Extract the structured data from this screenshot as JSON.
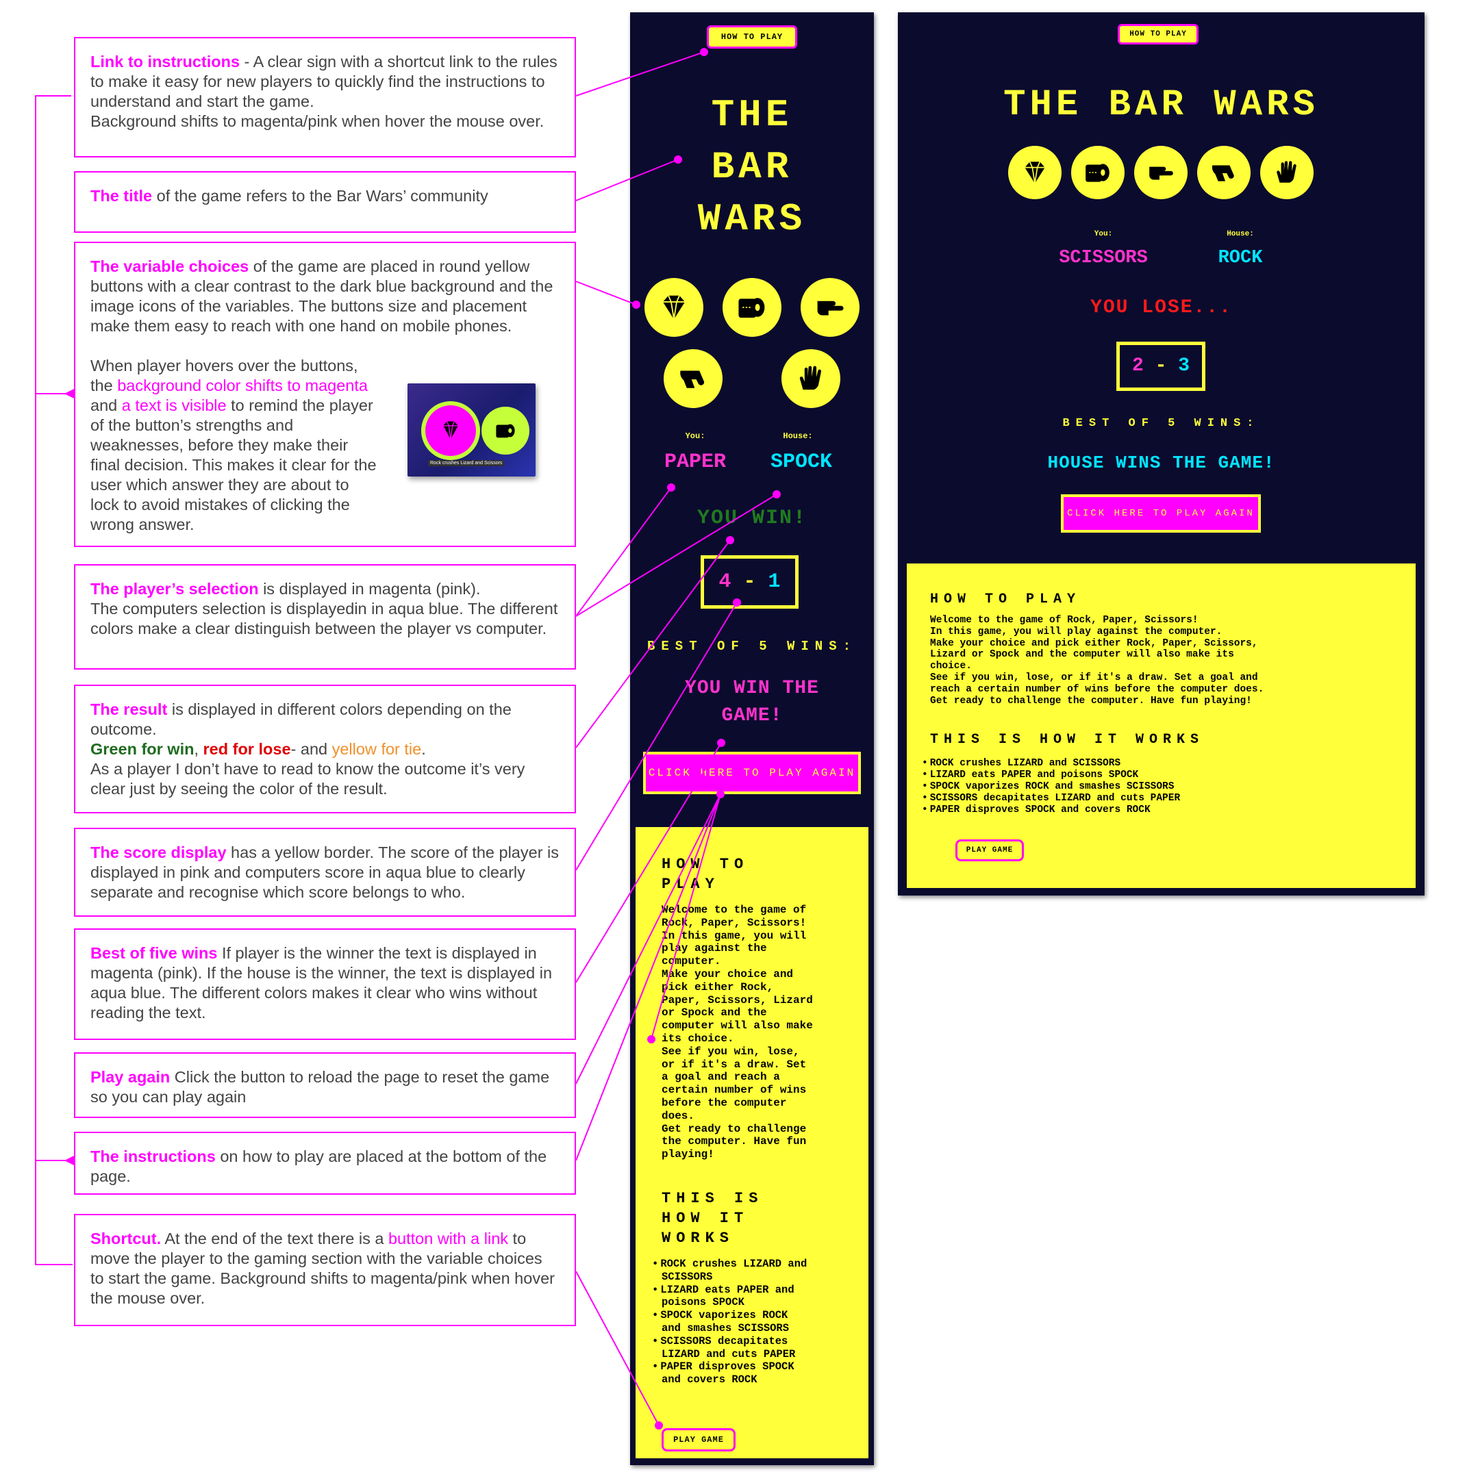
{
  "annotations": {
    "link": {
      "kw": "Link to instructions",
      "t1": " - A clear sign with a shortcut link to the rules to make it easy for new players to quickly find the instructions to understand and start the game.",
      "t2": "Background shifts to magenta/pink when hover the mouse over."
    },
    "title": {
      "kw": "The title",
      "t1": " of the game refers to the Bar Wars’ community"
    },
    "choices": {
      "kw": "The variable choices",
      "t1": " of the game are placed in round yellow buttons with a clear contrast to the dark blue background and the image icons of the variables. The buttons size and placement make them easy to reach with one hand on mobile phones.",
      "h1": "When player hovers over the buttons, the ",
      "h2": "background color shifts to magenta",
      "h3": " and ",
      "h4": "a text is visible",
      "h5": " to remind the player of the button’s strengths and weaknesses, before they make their final decision. This makes it clear for the user which answer they are about to lock to avoid mistakes of clicking the wrong answer.",
      "thumb_caption": "Rock crushes Lizard and Scissors"
    },
    "selection": {
      "kw": "The player’s selection",
      "t1": " is displayed in magenta (pink).",
      "t2": "The computers selection is displayedin in aqua blue. The different colors make a clear distinguish between the player vs computer."
    },
    "result": {
      "kw": "The result",
      "t1": " is displayed in different colors depending on the outcome.",
      "g": "Green for win",
      "c1": ", ",
      "r": "red for lose",
      "c2": "- and ",
      "y": "yellow for tie",
      "c3": ".",
      "t2": "As a player I don’t have to read to know the outcome it’s very clear just by seeing the color of the result."
    },
    "score": {
      "kw": "The score display",
      "t1": " has a yellow border. The score of the player is displayed in pink and computers score in aqua blue to clearly separate and recognise which score belongs to who."
    },
    "best": {
      "kw": "Best of five wins",
      "t1": " If player is the winner the text is displayed in magenta (pink). If the house is the winner, the text is displayed in aqua blue. The different colors makes it clear who wins without reading the text."
    },
    "again": {
      "kw": "Play again",
      "t1": " Click the button to reload the page to reset the game so you can  play again"
    },
    "instructions": {
      "kw": "The instructions",
      "t1": " on how to play are placed at the bottom of the page."
    },
    "shortcut": {
      "kw": "Shortcut.",
      "t1": " At the end of the text there is a ",
      "pk": "button with a link",
      "t2": " to move the player to the gaming section with the variable choices to start the game.  Background shifts to magenta/pink when hover the mouse over."
    }
  },
  "mobile": {
    "how_to_play_btn": "HOW TO PLAY",
    "title_lines": [
      "THE",
      "BAR",
      "WARS"
    ],
    "you_label": "You:",
    "house_label": "House:",
    "you_choice": "PAPER",
    "house_choice": "SPOCK",
    "result": "YOU WIN!",
    "score_player": "4",
    "score_sep": "-",
    "score_house": "1",
    "best_of": "BEST OF 5 WINS:",
    "final_lines": [
      "YOU WIN THE",
      "GAME!"
    ],
    "play_again": "CLICK HERE TO PLAY AGAIN",
    "how_title_lines": [
      "HOW TO",
      "PLAY"
    ],
    "how_text_lines": [
      "Welcome to the game of",
      "Rock, Paper, Scissors!",
      "In this game, you will",
      "play against the",
      "computer.",
      "Make your choice and",
      "pick either Rock,",
      "Paper, Scissors, Lizard",
      "or Spock and the",
      "computer will also make",
      "its choice.",
      "See if you win, lose,",
      "or if it's a draw. Set",
      "a goal and reach a",
      "certain number of wins",
      "before the computer",
      "does.",
      "Get ready to challenge",
      "the computer. Have fun",
      "playing!"
    ],
    "works_title_lines": [
      "THIS IS",
      "HOW IT",
      "WORKS"
    ],
    "rules": [
      [
        "ROCK crushes LIZARD and",
        "SCISSORS"
      ],
      [
        "LIZARD eats PAPER and",
        "poisons SPOCK"
      ],
      [
        "SPOCK vaporizes ROCK",
        "and smashes SCISSORS"
      ],
      [
        "SCISSORS decapitates",
        "LIZARD and cuts PAPER"
      ],
      [
        "PAPER disproves SPOCK",
        "and covers ROCK"
      ]
    ],
    "play_game": "PLAY GAME"
  },
  "desktop": {
    "how_to_play_btn": "HOW TO PLAY",
    "title": "THE BAR WARS",
    "you_label": "You:",
    "house_label": "House:",
    "you_choice": "SCISSORS",
    "house_choice": "ROCK",
    "result": "YOU LOSE...",
    "score_player": "2",
    "score_sep": "-",
    "score_house": "3",
    "best_of": "BEST OF 5 WINS:",
    "final": "HOUSE WINS THE GAME!",
    "play_again": "CLICK HERE TO PLAY AGAIN",
    "how_title": "HOW TO PLAY",
    "how_text_lines": [
      "Welcome to the game of Rock, Paper, Scissors!",
      "In this game, you will play against the computer.",
      "Make your choice and pick either Rock, Paper, Scissors,",
      "Lizard or Spock and the computer will also make its",
      "choice.",
      "See if you win, lose, or if it's a draw. Set a goal and",
      "reach a certain number of wins before the computer does.",
      "Get ready to challenge the computer. Have fun playing!"
    ],
    "works_title": "THIS IS HOW IT WORKS",
    "rules": [
      "ROCK crushes LIZARD and SCISSORS",
      "LIZARD eats PAPER and poisons SPOCK",
      "SPOCK vaporizes ROCK and smashes SCISSORS",
      "SCISSORS decapitates LIZARD and cuts PAPER",
      "PAPER disproves SPOCK and covers ROCK"
    ],
    "play_game": "PLAY GAME"
  },
  "icons": [
    "diamond-icon",
    "toilet-paper-icon",
    "scissors-hand-icon",
    "lizard-hand-icon",
    "spock-hand-icon"
  ],
  "colors": {
    "navy": "#0b0b2e",
    "yellow": "#ffff3a",
    "magenta": "#ff00ff",
    "pink": "#ff33cc",
    "aqua": "#00e5ff",
    "win_green": "#1f7a1f",
    "lose_red": "#ff1a1a"
  }
}
